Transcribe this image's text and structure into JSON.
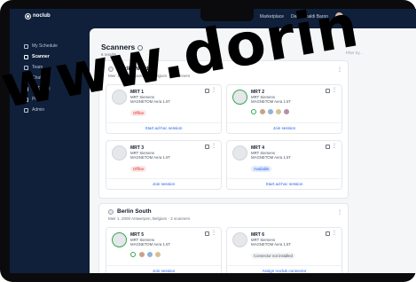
{
  "app": {
    "brand": "noclub"
  },
  "sidebar": {
    "items": [
      {
        "label": "My Schedule",
        "icon": "calendar-icon"
      },
      {
        "label": "Scanner",
        "icon": "scanner-icon",
        "active": true
      },
      {
        "label": "Team",
        "icon": "team-icon"
      },
      {
        "label": "Chats (4)",
        "icon": "chat-icon"
      },
      {
        "label": "To Do (4)",
        "icon": "todo-icon"
      },
      {
        "label": "Profile",
        "icon": "profile-icon"
      },
      {
        "label": "Admin",
        "icon": "admin-icon"
      }
    ]
  },
  "topbar": {
    "marketplace": "Marketplace",
    "user": "Dek Ronaldi Baron"
  },
  "page": {
    "title": "Scanners",
    "results": "6 results",
    "filter": "Filter by..."
  },
  "sites": [
    {
      "name": "Berlin Nord",
      "subtitle": "Meir 1, 2000 Antwerpen, Belgium - 2 scanners",
      "cards": [
        {
          "name": "MRT 1",
          "maker": "MRT Siemens",
          "model": "MAGNETOM Aera 1.5T",
          "state": "offline",
          "status": "Offline",
          "action": "Start ad-hoc session"
        },
        {
          "name": "MRT 2",
          "maker": "MRT Siemens",
          "model": "MAGNETOM Aera 1.5T",
          "state": "busy",
          "action": "Join session"
        },
        {
          "name": "MRT 3",
          "maker": "MRT Siemens",
          "model": "MAGNETOM Aera 1.5T",
          "state": "offline",
          "status": "Offline",
          "action": "Join session"
        },
        {
          "name": "MRT 4",
          "maker": "MRT Siemens",
          "model": "MAGNETOM Aera 1.5T",
          "state": "available",
          "status": "Available",
          "action": "Start ad-hoc session"
        }
      ]
    },
    {
      "name": "Berlin South",
      "subtitle": "Meir 1, 2000 Antwerpen, Belgium - 2 scanners",
      "cards": [
        {
          "name": "MRT 5",
          "maker": "MRT Siemens",
          "model": "MAGNETOM Aera 1.5T",
          "state": "busy",
          "action": "Join session"
        },
        {
          "name": "MRT 6",
          "maker": "MRT Siemens",
          "model": "MAGNETOM Aera 1.5T",
          "state": "notinstalled",
          "status": "Connector not installed",
          "action": "Assign noclub connector"
        }
      ]
    }
  ],
  "watermark": "www.dorin",
  "colors": {
    "accent": "#2563eb",
    "offline": "#d93025",
    "busy": "#34a853",
    "sidebar": "#10203a"
  }
}
